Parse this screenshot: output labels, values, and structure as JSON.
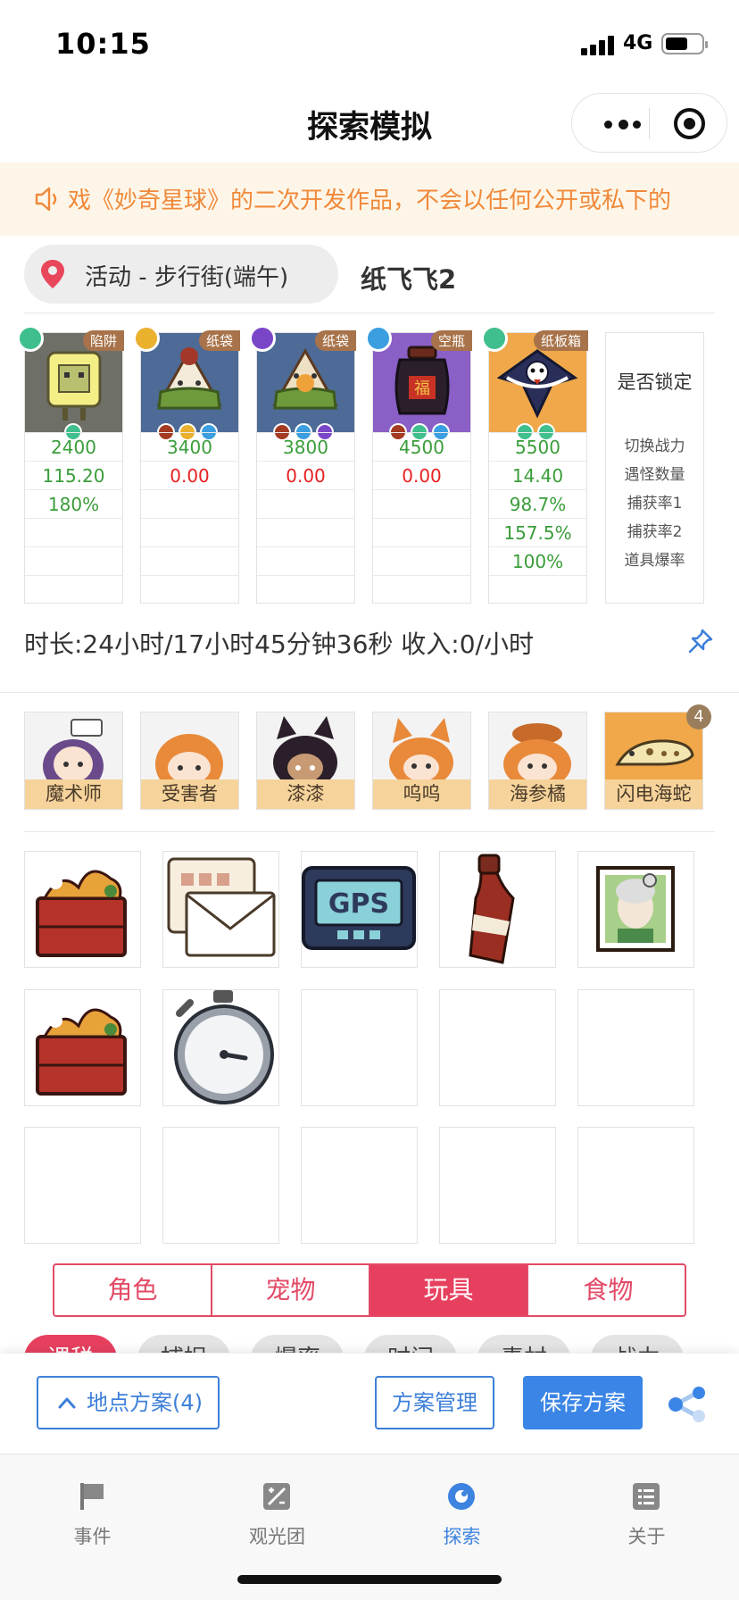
{
  "status_bar": {
    "time": "10:15",
    "network": "4G"
  },
  "nav": {
    "title": "探索模拟"
  },
  "notice": {
    "text": "戏《妙奇星球》的二次开发作品，不会以任何公开或私下的"
  },
  "location": {
    "label": "活动 - 步行街(端午)",
    "name": "纸飞飞2"
  },
  "pets": [
    {
      "tag": "陷阱",
      "values": [
        "2400",
        "115.20",
        "180%",
        "",
        "",
        ""
      ]
    },
    {
      "tag": "纸袋",
      "values": [
        "3400",
        "0.00",
        "",
        "",
        "",
        ""
      ]
    },
    {
      "tag": "纸袋",
      "values": [
        "3800",
        "0.00",
        "",
        "",
        "",
        ""
      ]
    },
    {
      "tag": "空瓶",
      "values": [
        "4500",
        "0.00",
        "",
        "",
        "",
        ""
      ]
    },
    {
      "tag": "纸板箱",
      "values": [
        "5500",
        "14.40",
        "98.7%",
        "157.5%",
        "100%",
        ""
      ]
    }
  ],
  "lock_column": {
    "header": "是否锁定",
    "rows": [
      "切换战力",
      "遇怪数量",
      "捕获率1",
      "捕获率2",
      "道具爆率"
    ]
  },
  "summary": "时长:24小时/17小时45分钟36秒 收入:0/小时",
  "guests": [
    {
      "label": "魔术师"
    },
    {
      "label": "受害者"
    },
    {
      "label": "漆漆"
    },
    {
      "label": "呜呜"
    },
    {
      "label": "海参橘"
    },
    {
      "label": "闪电海蛇"
    }
  ],
  "guest_badge": "4",
  "item_icons": [
    "bento-box-icon",
    "letter-icon",
    "gps-icon",
    "bottle-icon",
    "portrait-icon",
    "bento-box-icon",
    "stopwatch-icon"
  ],
  "tabs": [
    {
      "label": "角色"
    },
    {
      "label": "宠物"
    },
    {
      "label": "玩具"
    },
    {
      "label": "食物"
    }
  ],
  "active_tab": "玩具",
  "chips": [
    {
      "label": "课税"
    },
    {
      "label": "捕捉"
    },
    {
      "label": "爆率"
    },
    {
      "label": "时间"
    },
    {
      "label": "素材"
    },
    {
      "label": "战力"
    }
  ],
  "actions": {
    "plans": "地点方案(4)",
    "manage": "方案管理",
    "save": "保存方案"
  },
  "tabbar": [
    {
      "label": "事件"
    },
    {
      "label": "观光团"
    },
    {
      "label": "探索"
    },
    {
      "label": "关于"
    }
  ],
  "colors": {
    "accent": "#e7405f",
    "primary": "#3a85e6",
    "notice_text": "#f0893a",
    "value_green": "#3a9d3a",
    "value_red": "#e62222"
  }
}
